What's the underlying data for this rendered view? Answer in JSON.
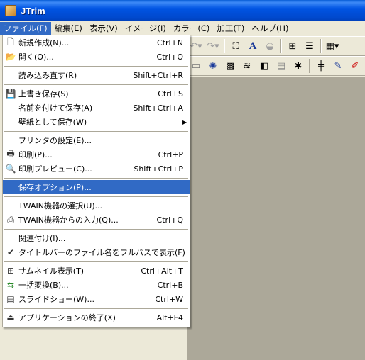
{
  "window": {
    "title": "JTrim"
  },
  "menubar": [
    "ファイル(F)",
    "編集(E)",
    "表示(V)",
    "イメージ(I)",
    "カラー(C)",
    "加工(T)",
    "ヘルプ(H)"
  ],
  "file_menu": {
    "items": [
      {
        "label": "新規作成(N)...",
        "shortcut": "Ctrl+N",
        "icon": "new-document-icon"
      },
      {
        "label": "開く(O)...",
        "shortcut": "Ctrl+O",
        "icon": "open-folder-icon"
      },
      {
        "label": "読み込み直す(R)",
        "shortcut": "Shift+Ctrl+R"
      },
      {
        "label": "上書き保存(S)",
        "shortcut": "Ctrl+S",
        "icon": "save-icon"
      },
      {
        "label": "名前を付けて保存(A)",
        "shortcut": "Shift+Ctrl+A"
      },
      {
        "label": "壁紙として保存(W)",
        "shortcut": ""
      },
      {
        "label": "プリンタの設定(E)...",
        "shortcut": ""
      },
      {
        "label": "印刷(P)...",
        "shortcut": "Ctrl+P",
        "icon": "printer-icon"
      },
      {
        "label": "印刷プレビュー(C)...",
        "shortcut": "Shift+Ctrl+P",
        "icon": "print-preview-icon"
      },
      {
        "label": "保存オプション(P)...",
        "shortcut": ""
      },
      {
        "label": "TWAIN機器の選択(U)...",
        "shortcut": ""
      },
      {
        "label": "TWAIN機器からの入力(Q)...",
        "shortcut": "Ctrl+Q",
        "icon": "scanner-icon"
      },
      {
        "label": "関連付け(I)...",
        "shortcut": ""
      },
      {
        "label": "タイトルバーのファイル名をフルパスで表示(F)",
        "shortcut": ""
      },
      {
        "label": "サムネイル表示(T)",
        "shortcut": "Ctrl+Alt+T",
        "icon": "thumbnail-grid-icon"
      },
      {
        "label": "一括変換(B)...",
        "shortcut": "Ctrl+B",
        "icon": "batch-convert-icon"
      },
      {
        "label": "スライドショー(W)...",
        "shortcut": "Ctrl+W",
        "icon": "slideshow-icon"
      },
      {
        "label": "アプリケーションの終了(X)",
        "shortcut": "Alt+F4",
        "icon": "exit-icon"
      }
    ]
  }
}
